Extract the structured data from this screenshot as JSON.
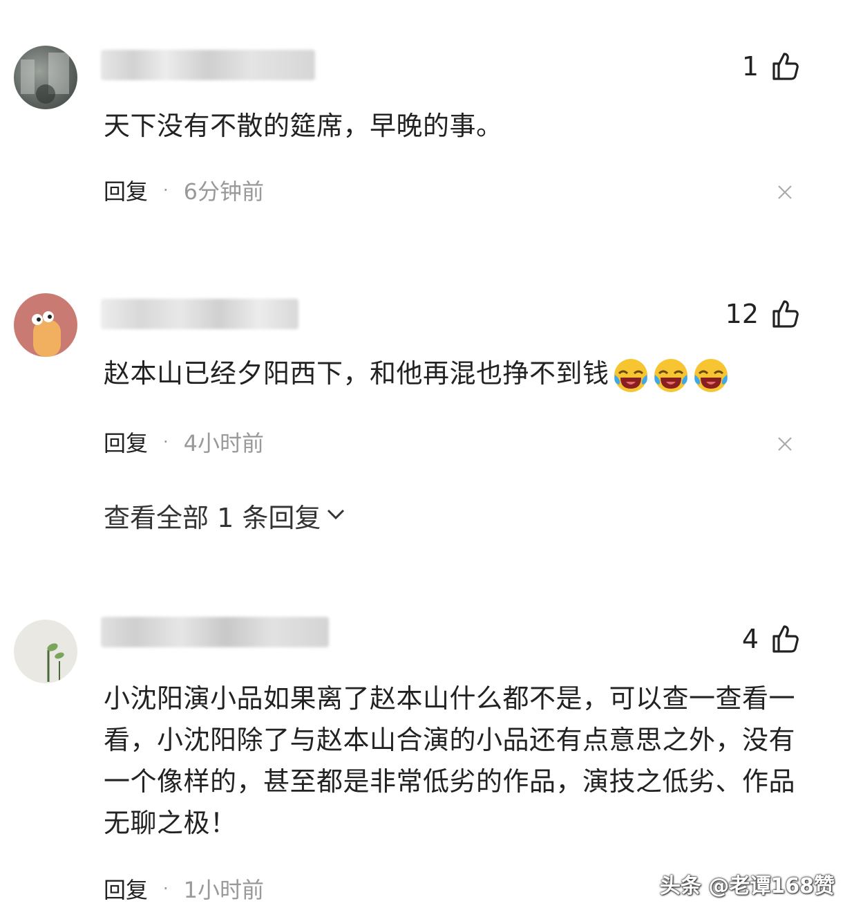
{
  "comments": [
    {
      "likes": "1",
      "text": "天下没有不散的筵席，早晚的事。",
      "reply_label": "回复",
      "separator": "·",
      "time": "6分钟前"
    },
    {
      "likes": "12",
      "text": "赵本山已经夕阳西下，和他再混也挣不到钱",
      "reply_label": "回复",
      "separator": "·",
      "time": "4小时前",
      "view_all_label": "查看全部 1 条回复"
    },
    {
      "likes": "4",
      "text": "小沈阳演小品如果离了赵本山什么都不是，可以查一查看一看，小沈阳除了与赵本山合演的小品还有点意思之外，没有一个像样的，甚至都是非常低劣的作品，演技之低劣、作品无聊之极！",
      "reply_label": "回复",
      "separator": "·",
      "time": "1小时前"
    }
  ],
  "watermark": "头条 @老谭168赞",
  "colors": {
    "text": "#222222",
    "muted": "#999999",
    "background": "#ffffff"
  },
  "icons": [
    "thumbs-up-icon",
    "close-icon",
    "chevron-down-icon",
    "laughing-crying-emoji"
  ]
}
